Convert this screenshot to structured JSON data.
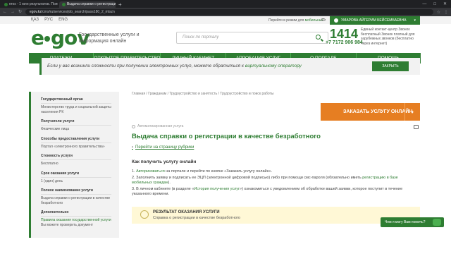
{
  "browser": {
    "tabs": [
      {
        "title": "eros - 1 млн результатов. Поис"
      },
      {
        "title": "Выдача справки о регистрации"
      }
    ],
    "new_tab": "+",
    "controls": {
      "min": "—",
      "max": "□",
      "close": "✕"
    },
    "url_host": "egov.kz",
    "url_path": "/cms/ru/services/job_search/pass180_2_mtszn",
    "back": "←",
    "forward": "→",
    "reload": "↻"
  },
  "header": {
    "languages": [
      "ҚАЗ",
      "РУС",
      "ENG"
    ],
    "mobile_link": "Перейти в режим для",
    "mobile_link_hl": " мобильных",
    "user_name": "УМАРОВА АЙГЕРИМ БЕЙСЕМБАЕВНА",
    "logo_left": "e",
    "logo_right": "gov",
    "tagline": "Государственные услуги и информация онлайн",
    "search_placeholder": "Поиск по порталу",
    "contact_number": "1414",
    "contact_phone": "+7 7172 906 984",
    "contact_info": "Единый контакт-центр Звонок бесплатный Звонок платный для зарубежных звонков (бесплатно через интернет)"
  },
  "nav": [
    "ПЛАТЕЖИ",
    "ОТКРЫТОЕ ПРАВИТЕЛЬСТВО",
    "ЛИЧНЫЙ КАБИНЕТ",
    "АПРОБАЦИЯ УСЛУГ",
    "О ПОРТАЛЕ",
    "ПОМОЩЬ"
  ],
  "notice": {
    "text": "Если у вас возникли сложности при получении электронных услуг, можете обратиться к ",
    "link": "виртуальному оператору",
    "button": "ЗАКРЫТЬ"
  },
  "sidebar": [
    {
      "label": "Государственный орган",
      "value": "Министерство труда и социальной защиты населения РК"
    },
    {
      "label": "Получатели услуги",
      "value": "Физические лица"
    },
    {
      "label": "Способы предоставления услуги",
      "value": "Портал «электронного правительства»"
    },
    {
      "label": "Стоимость услуги",
      "value": "Бесплатно"
    },
    {
      "label": "Срок оказания услуги",
      "value": "1 (один) день"
    },
    {
      "label": "Полное наименование услуги",
      "value": "Выдача справки о регистрации в качестве безработного"
    },
    {
      "label": "Дополнительно",
      "value": "Правила оказания государственной услуги",
      "value2": "Вы можете проверить документ"
    }
  ],
  "main": {
    "breadcrumb": "Главная / Гражданам / Трудоустройство и занятость / Трудоустройство и поиск работы",
    "order_button": "ЗАКАЗАТЬ УСЛУГУ ОНЛАЙН",
    "order_arrow": "›",
    "auto_badge": "Автоматизированная услуга",
    "title": "Выдача справки о регистрации в качестве безработного",
    "back_link": "Перейти на страницу рубрики",
    "back_chevron": "‹",
    "how_title": "Как получить услугу онлайн",
    "steps": [
      {
        "num": "1.",
        "link": "Авторизоваться",
        "text": " на портале и перейти по кнопке «Заказать услугу онлайн»."
      },
      {
        "num": "2.",
        "text": "Заполнить заявку и подписать ее ЭЦП (электронной цифровой подписью) либо при помощи смс-пароля (обязательно иметь ",
        "link": "регистрацию в базе мобильных граждан",
        "text2": ")."
      },
      {
        "num": "3.",
        "text": "В личном кабинете (в разделе «",
        "link": "История получения услуг",
        "text2": "») ознакомиться с уведомлением об обработке вашей заявки, которое поступит в течение указанного времени."
      }
    ],
    "result_title": "РЕЗУЛЬТАТ ОКАЗАНИЯ УСЛУГИ",
    "result_sub": "Справка о регистрации в качестве безработного"
  },
  "chat": {
    "label": "Чем я могу Вам помочь?"
  }
}
